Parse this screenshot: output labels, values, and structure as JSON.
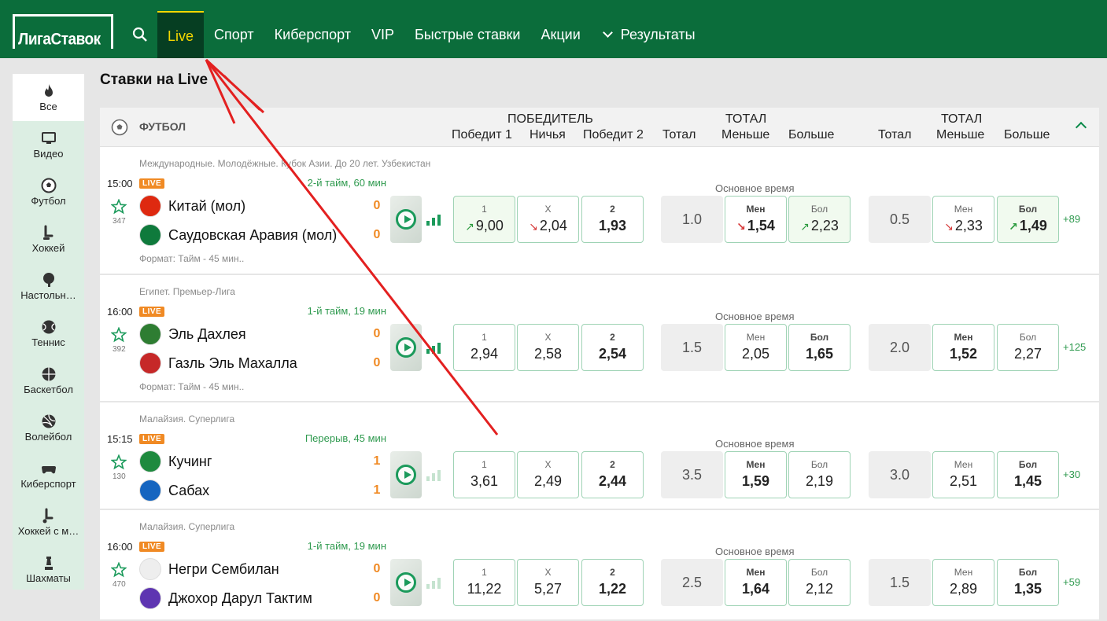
{
  "brand": {
    "logo_text": "ЛигаСтавок"
  },
  "nav": [
    {
      "label": "Live",
      "active": true
    },
    {
      "label": "Спорт"
    },
    {
      "label": "Киберспорт"
    },
    {
      "label": "VIP"
    },
    {
      "label": "Быстрые ставки"
    },
    {
      "label": "Акции"
    },
    {
      "label": "Результаты",
      "icon": "chevron-down-icon"
    }
  ],
  "sidebar": [
    {
      "label": "Все",
      "icon": "fire-icon",
      "active": true
    },
    {
      "label": "Видео",
      "icon": "monitor-icon"
    },
    {
      "label": "Футбол",
      "icon": "soccer-ball-icon"
    },
    {
      "label": "Хоккей",
      "icon": "hockey-stick-icon"
    },
    {
      "label": "Настольн…",
      "icon": "table-tennis-icon"
    },
    {
      "label": "Теннис",
      "icon": "tennis-ball-icon"
    },
    {
      "label": "Баскетбол",
      "icon": "basketball-icon"
    },
    {
      "label": "Волейбол",
      "icon": "volleyball-icon"
    },
    {
      "label": "Киберспорт",
      "icon": "gamepad-icon"
    },
    {
      "label": "Хоккей с м…",
      "icon": "bandy-icon"
    },
    {
      "label": "Шахматы",
      "icon": "chess-icon"
    }
  ],
  "page_title": "Ставки на Live",
  "header": {
    "sport": "ФУТБОЛ",
    "winner_group": "ПОБЕДИТЕЛЬ",
    "win1": "Победит 1",
    "draw": "Ничья",
    "win2": "Победит 2",
    "total": "Тотал",
    "total_group": "ТОТАЛ",
    "less": "Меньше",
    "more": "Больше"
  },
  "matches": [
    {
      "league": "Международные. Молодёжные. Кубок Азии. До 20 лет. Узбекистан",
      "time": "15:00",
      "live": "LIVE",
      "period": "2-й тайм, 60 мин",
      "favorites": "347",
      "team1": "Китай (мол)",
      "team2": "Саудовская Аравия (мол)",
      "score1": "0",
      "score2": "0",
      "format": "Формат: Тайм - 45 мин..",
      "main_time": "Основное время",
      "odds": {
        "w1": {
          "label": "1",
          "value": "9,00",
          "trend": "up",
          "bold": false
        },
        "x": {
          "label": "X",
          "value": "2,04",
          "trend": "down",
          "bold": false
        },
        "w2": {
          "label": "2",
          "value": "1,93",
          "trend": "",
          "bold": true
        },
        "t1": "1.0",
        "t1_less": {
          "label": "Мен",
          "value": "1,54",
          "trend": "down",
          "bold": true
        },
        "t1_more": {
          "label": "Бол",
          "value": "2,23",
          "trend": "up",
          "bold": false
        },
        "t2": "0.5",
        "t2_less": {
          "label": "Мен",
          "value": "2,33",
          "trend": "down",
          "bold": false
        },
        "t2_more": {
          "label": "Бол",
          "value": "1,49",
          "trend": "up",
          "bold": true
        }
      },
      "more": "+89",
      "stats_active": true
    },
    {
      "league": "Египет. Премьер-Лига",
      "time": "16:00",
      "live": "LIVE",
      "period": "1-й тайм, 19 мин",
      "favorites": "392",
      "team1": "Эль Дахлея",
      "team2": "Газль Эль Махалла",
      "score1": "0",
      "score2": "0",
      "format": "Формат: Тайм - 45 мин..",
      "main_time": "Основное время",
      "odds": {
        "w1": {
          "label": "1",
          "value": "2,94",
          "trend": "",
          "bold": false
        },
        "x": {
          "label": "X",
          "value": "2,58",
          "trend": "",
          "bold": false
        },
        "w2": {
          "label": "2",
          "value": "2,54",
          "trend": "",
          "bold": true
        },
        "t1": "1.5",
        "t1_less": {
          "label": "Мен",
          "value": "2,05",
          "trend": "",
          "bold": false
        },
        "t1_more": {
          "label": "Бол",
          "value": "1,65",
          "trend": "",
          "bold": true
        },
        "t2": "2.0",
        "t2_less": {
          "label": "Мен",
          "value": "1,52",
          "trend": "",
          "bold": true
        },
        "t2_more": {
          "label": "Бол",
          "value": "2,27",
          "trend": "",
          "bold": false
        }
      },
      "more": "+125",
      "stats_active": true
    },
    {
      "league": "Малайзия. Суперлига",
      "time": "15:15",
      "live": "LIVE",
      "period": "Перерыв, 45 мин",
      "favorites": "130",
      "team1": "Кучинг",
      "team2": "Сабах",
      "score1": "1",
      "score2": "1",
      "format": "",
      "main_time": "Основное время",
      "odds": {
        "w1": {
          "label": "1",
          "value": "3,61",
          "trend": "",
          "bold": false
        },
        "x": {
          "label": "X",
          "value": "2,49",
          "trend": "",
          "bold": false
        },
        "w2": {
          "label": "2",
          "value": "2,44",
          "trend": "",
          "bold": true
        },
        "t1": "3.5",
        "t1_less": {
          "label": "Мен",
          "value": "1,59",
          "trend": "",
          "bold": true
        },
        "t1_more": {
          "label": "Бол",
          "value": "2,19",
          "trend": "",
          "bold": false
        },
        "t2": "3.0",
        "t2_less": {
          "label": "Мен",
          "value": "2,51",
          "trend": "",
          "bold": false
        },
        "t2_more": {
          "label": "Бол",
          "value": "1,45",
          "trend": "",
          "bold": true
        }
      },
      "more": "+30",
      "stats_active": false
    },
    {
      "league": "Малайзия. Суперлига",
      "time": "16:00",
      "live": "LIVE",
      "period": "1-й тайм, 19 мин",
      "favorites": "470",
      "team1": "Негри Сембилан",
      "team2": "Джохор Дарул Тактим",
      "score1": "0",
      "score2": "0",
      "format": "",
      "main_time": "Основное время",
      "odds": {
        "w1": {
          "label": "1",
          "value": "11,22",
          "trend": "",
          "bold": false
        },
        "x": {
          "label": "X",
          "value": "5,27",
          "trend": "",
          "bold": false
        },
        "w2": {
          "label": "2",
          "value": "1,22",
          "trend": "",
          "bold": true
        },
        "t1": "2.5",
        "t1_less": {
          "label": "Мен",
          "value": "1,64",
          "trend": "",
          "bold": true
        },
        "t1_more": {
          "label": "Бол",
          "value": "2,12",
          "trend": "",
          "bold": false
        },
        "t2": "1.5",
        "t2_less": {
          "label": "Мен",
          "value": "2,89",
          "trend": "",
          "bold": false
        },
        "t2_more": {
          "label": "Бол",
          "value": "1,35",
          "trend": "",
          "bold": true
        }
      },
      "more": "+59",
      "stats_active": false
    }
  ],
  "colors": {
    "brand_green": "#0b6d3b",
    "accent_yellow": "#f5d800",
    "live_orange": "#f08a24",
    "odds_border": "#9fd3b5",
    "annotation_red": "#e32020"
  }
}
